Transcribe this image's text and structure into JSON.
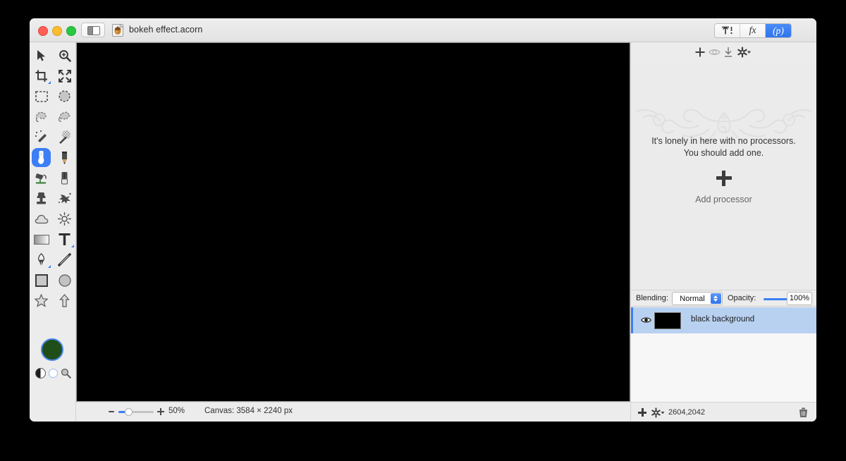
{
  "window": {
    "title": "bokeh effect.acorn",
    "doc_icon": "acorn-document-icon",
    "sidebar_toggle_icon": "sidebar-toggle-icon",
    "traffic_lights": [
      "close",
      "minimize",
      "zoom"
    ],
    "accent_color": "#3c7ef5",
    "chrome_color": "#ececec"
  },
  "segmented_control": {
    "tabs": [
      {
        "id": "inspector",
        "label": "",
        "icon": "tool-options-icon",
        "active": false
      },
      {
        "id": "filters",
        "label": "fx",
        "icon": "fx-icon",
        "active": false
      },
      {
        "id": "processors",
        "label": "(p)",
        "icon": "processor-icon",
        "active": true
      }
    ]
  },
  "tools": {
    "items": [
      {
        "name": "move-tool",
        "icon": "arrow-cursor-icon",
        "selected": false,
        "submenu": false
      },
      {
        "name": "zoom-tool",
        "icon": "magnifier-plus-icon",
        "selected": false,
        "submenu": false
      },
      {
        "name": "crop-tool",
        "icon": "crop-icon",
        "selected": false,
        "submenu": true
      },
      {
        "name": "transform-tool",
        "icon": "four-arrows-icon",
        "selected": false,
        "submenu": false
      },
      {
        "name": "rectangular-select-tool",
        "icon": "dashed-rectangle-icon",
        "selected": false,
        "submenu": false
      },
      {
        "name": "elliptical-select-tool",
        "icon": "dashed-circle-icon",
        "selected": false,
        "submenu": false
      },
      {
        "name": "lasso-tool",
        "icon": "lasso-icon",
        "selected": false,
        "submenu": false
      },
      {
        "name": "polygon-lasso-tool",
        "icon": "polygon-lasso-icon",
        "selected": false,
        "submenu": false
      },
      {
        "name": "magic-wand-tool",
        "icon": "magic-wand-icon",
        "selected": false,
        "submenu": false
      },
      {
        "name": "instant-alpha-tool",
        "icon": "checkered-wand-icon",
        "selected": false,
        "submenu": false
      },
      {
        "name": "brush-tool",
        "icon": "paintbrush-icon",
        "selected": true,
        "submenu": false
      },
      {
        "name": "pencil-tool",
        "icon": "pencil-icon",
        "selected": false,
        "submenu": false
      },
      {
        "name": "paint-bucket-tool",
        "icon": "paint-bucket-icon",
        "selected": false,
        "submenu": false
      },
      {
        "name": "eraser-tool",
        "icon": "eraser-icon",
        "selected": false,
        "submenu": false
      },
      {
        "name": "clone-stamp-tool",
        "icon": "clone-stamp-icon",
        "selected": false,
        "submenu": false
      },
      {
        "name": "smudge-tool",
        "icon": "smudge-splatter-icon",
        "selected": false,
        "submenu": false
      },
      {
        "name": "blur-tool",
        "icon": "cloud-icon",
        "selected": false,
        "submenu": false
      },
      {
        "name": "dodge-tool",
        "icon": "sun-icon",
        "selected": false,
        "submenu": false
      },
      {
        "name": "gradient-tool",
        "icon": "gradient-icon",
        "selected": false,
        "submenu": false
      },
      {
        "name": "text-tool",
        "icon": "text-t-icon",
        "selected": false,
        "submenu": true
      },
      {
        "name": "pen-tool",
        "icon": "fountain-pen-icon",
        "selected": false,
        "submenu": true
      },
      {
        "name": "line-tool",
        "icon": "line-icon",
        "selected": false,
        "submenu": false
      },
      {
        "name": "rectangle-shape-tool",
        "icon": "square-icon",
        "selected": false,
        "submenu": false
      },
      {
        "name": "ellipse-shape-tool",
        "icon": "circle-icon",
        "selected": false,
        "submenu": false
      },
      {
        "name": "star-shape-tool",
        "icon": "star-icon",
        "selected": false,
        "submenu": false
      },
      {
        "name": "arrow-shape-tool",
        "icon": "up-arrow-icon",
        "selected": false,
        "submenu": false
      }
    ],
    "colors": {
      "foreground": "#1f4e18",
      "background": "#ffffff",
      "swatch_ring": "#4a86e8",
      "palette_icon": "half-filled-circle-icon",
      "picker_icon": "color-picker-icon"
    }
  },
  "processors_panel": {
    "toolbar_icons": [
      "add-icon",
      "preview-eye-icon",
      "download-icon",
      "settings-gear-icon"
    ],
    "empty_message_line1": "It's lonely in here with no processors.",
    "empty_message_line2": "You should add one.",
    "add_label": "Add processor",
    "add_icon": "plus-icon",
    "ornament": "decorative-flourish-ornament"
  },
  "layers_panel": {
    "blending_label": "Blending:",
    "blending_value": "Normal",
    "opacity_label": "Opacity:",
    "opacity_value": "100%",
    "opacity_percent": 100,
    "rows": [
      {
        "name": "black background",
        "visible": true,
        "selected": true,
        "thumbnail_color": "#000000",
        "visibility_icon": "eye-icon"
      }
    ],
    "footer": {
      "add_icon": "plus-icon",
      "gear_icon": "settings-gear-icon",
      "coordinates": "2604,2042",
      "delete_icon": "trash-icon"
    }
  },
  "status_bar": {
    "zoom_out_icon": "minus-icon",
    "zoom_in_icon": "plus-icon",
    "zoom_level": "50%",
    "zoom_percent": 50,
    "canvas_info": "Canvas: 3584 × 2240 px"
  },
  "canvas": {
    "background_color": "#000000"
  }
}
